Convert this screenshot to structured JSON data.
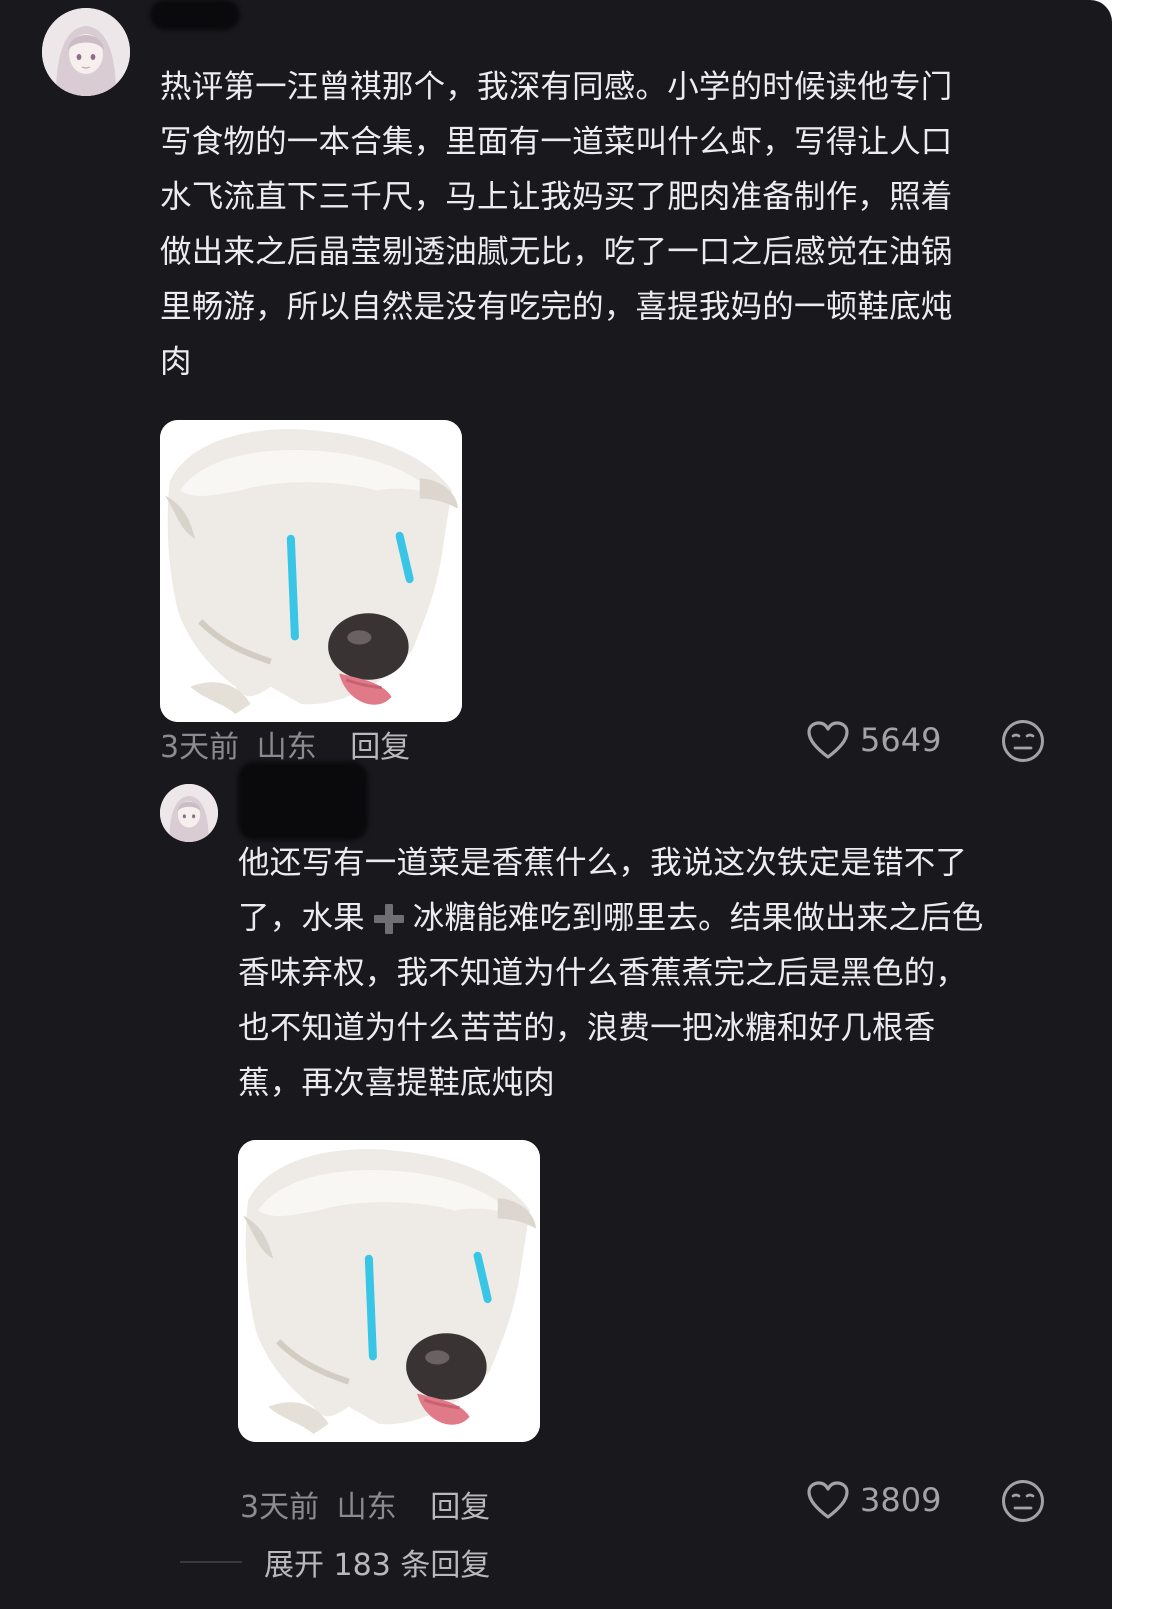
{
  "comments": [
    {
      "text": "热评第一汪曾祺那个，我深有同感。小学的时候读他专门\n写食物的一本合集，里面有一道菜叫什么虾，写得让人口\n水飞流直下三千尺，马上让我妈买了肥肉准备制作，照着\n做出来之后晶莹剔透油腻无比，吃了一口之后感觉在油锅\n里畅游，所以自然是没有吃完的，喜提我妈的一顿鞋底炖\n肉",
      "time": "3天前",
      "location": "山东",
      "reply_label": "回复",
      "likes": "5649"
    },
    {
      "text_part1": "他还写有一道菜是香蕉什么，我说这次铁定是错不了\n了，水果",
      "text_part2": "冰糖能难吃到哪里去。结果做出来之后色\n香味弃权，我不知道为什么香蕉煮完之后是黑色的，\n也不知道为什么苦苦的，浪费一把冰糖和好几根香\n蕉，再次喜提鞋底炖肉",
      "time": "3天前",
      "location": "山东",
      "reply_label": "回复",
      "likes": "3809"
    }
  ],
  "expand_replies": "展开 183 条回复",
  "icons": {
    "like": "heart-outline-icon",
    "dislike": "meh-face-icon",
    "plus_emoji": "plus-sign-emoji"
  },
  "colors": {
    "background": "#19181d",
    "text": "#ececee",
    "meta": "#8b8a90",
    "tear": "#39c6e6"
  }
}
